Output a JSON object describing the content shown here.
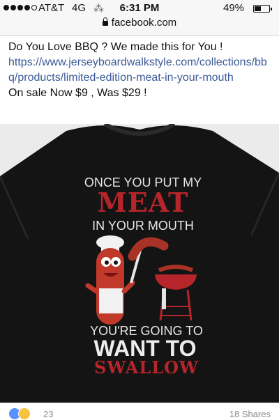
{
  "status_bar": {
    "carrier": "AT&T",
    "network": "4G",
    "activity_glyph": "⁂",
    "time": "6:31 PM",
    "battery": "49%",
    "battery_level": 0.49
  },
  "browser": {
    "url": "facebook.com"
  },
  "post": {
    "line1": "Do You Love BBQ ? We made this for You !",
    "link": "https://www.jerseyboardwalkstyle.com/collections/bbq/products/limited-edition-meat-in-your-mouth",
    "line2": "On sale Now $9 , Was $29 !"
  },
  "shirt": {
    "top": "ONCE YOU PUT MY",
    "big": "MEAT",
    "mid": "IN YOUR MOUTH",
    "bottom1": "YOU'RE GOING TO",
    "bottom2": "WANT TO",
    "bottom3": "SWALLOW"
  },
  "footer": {
    "reactions": "23",
    "shares": "18 Shares"
  },
  "colors": {
    "link": "#3b5998",
    "shirt": "#141414",
    "print_red": "#b5252a",
    "print_white": "#e6e6e6"
  }
}
